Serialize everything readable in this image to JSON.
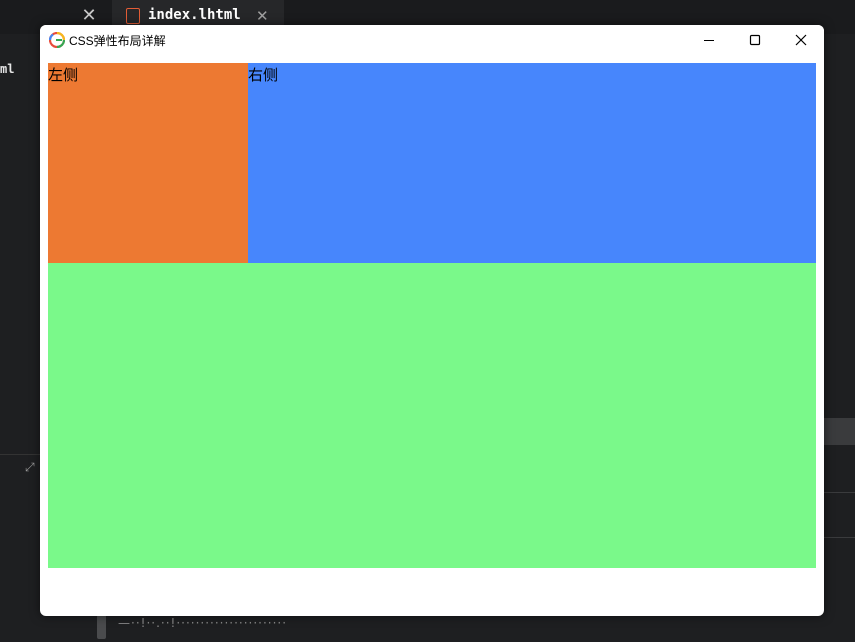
{
  "editor": {
    "tab_close_glyph": "✕",
    "active_tab_file": "index.lhtml",
    "active_tab_close_glyph": "✕",
    "sidebar_fragment": "ml",
    "bottom_text": "—··!··.··!·······················"
  },
  "window": {
    "title": "CSS弹性布局详解",
    "controls": [
      "minimize",
      "maximize",
      "close"
    ]
  },
  "page": {
    "left_label": "左侧",
    "right_label": "右侧"
  },
  "colors": {
    "left_box": "#ed7932",
    "right_box": "#4786fc",
    "bottom_box": "#7af98a",
    "file_icon": "#e35d36"
  },
  "icons": {
    "app": "browser-logo-icon",
    "minimize": "minimize-icon",
    "maximize": "maximize-icon",
    "close": "close-icon",
    "expand": "expand-icon",
    "file": "html-file-icon"
  }
}
